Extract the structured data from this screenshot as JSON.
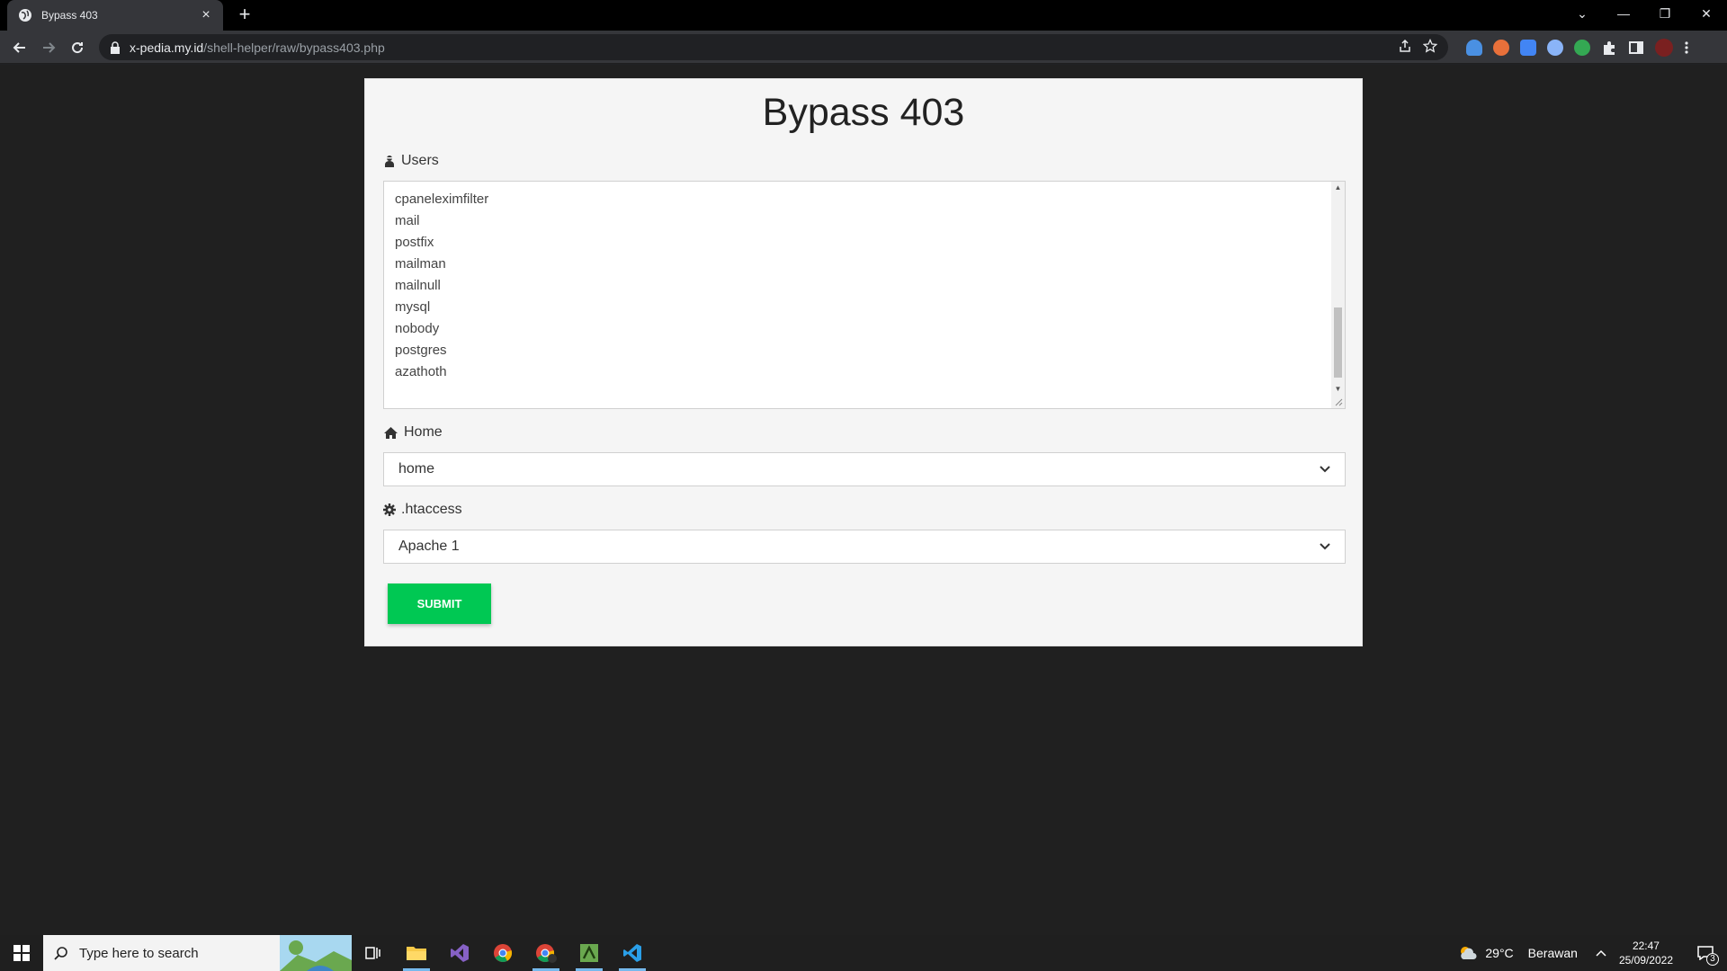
{
  "browser": {
    "tab_title": "Bypass 403",
    "url_host": "x-pedia.my.id",
    "url_path": "/shell-helper/raw/bypass403.php"
  },
  "page": {
    "title": "Bypass 403",
    "users_label": "Users",
    "users": [
      "cpaneleximfilter",
      "mail",
      "postfix",
      "mailman",
      "mailnull",
      "mysql",
      "nobody",
      "postgres",
      "azathoth"
    ],
    "home_label": "Home",
    "home_value": "home",
    "htaccess_label": ".htaccess",
    "htaccess_value": "Apache 1",
    "submit_label": "SUBMIT"
  },
  "taskbar": {
    "search_placeholder": "Type here to search",
    "weather_temp": "29°C",
    "weather_text": "Berawan",
    "time": "22:47",
    "date": "25/09/2022",
    "notifications": "3"
  },
  "colors": {
    "submit_bg": "#00c853",
    "page_bg": "#202020",
    "card_bg": "#f5f5f5"
  }
}
